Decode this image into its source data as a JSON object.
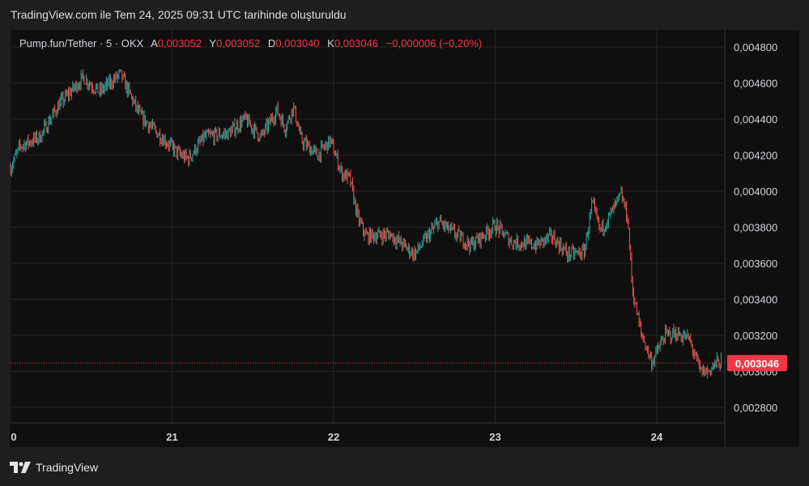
{
  "caption": "TradingView.com ile Tem 24, 2025 09:31 UTC tarihinde oluşturuldu",
  "legend": {
    "symbol": "Pump.fun/Tether · 5 · OKX",
    "open_label": "A",
    "open": "0,003052",
    "high_label": "Y",
    "high": "0,003052",
    "low_label": "D",
    "low": "0,003040",
    "close_label": "K",
    "close": "0,003046",
    "change": "−0,000006 (−0,20%)"
  },
  "footer": {
    "logo_icon": "tradingview-logo-icon",
    "brand": "TradingView"
  },
  "colors": {
    "up": "#26a69a",
    "down": "#ef5350",
    "price_tag": "#f23645",
    "grid": "#232323"
  },
  "chart_data": {
    "type": "candlestick",
    "x_ticks": [
      "0",
      "21",
      "22",
      "23",
      "24"
    ],
    "y_ticks": [
      "0,004800",
      "0,004600",
      "0,004400",
      "0,004200",
      "0,004000",
      "0,003800",
      "0,003600",
      "0,003400",
      "0,003200",
      "0,003000",
      "0,002800"
    ],
    "ylim": [
      0.00275,
      0.00493
    ],
    "last_price": 0.003046,
    "last_price_label": "0,003046",
    "approx_close_path": [
      [
        0,
        0.00413
      ],
      [
        0.06,
        0.00425
      ],
      [
        0.18,
        0.0043
      ],
      [
        0.3,
        0.00448
      ],
      [
        0.45,
        0.00463
      ],
      [
        0.55,
        0.00455
      ],
      [
        0.68,
        0.00465
      ],
      [
        0.8,
        0.00442
      ],
      [
        0.9,
        0.00433
      ],
      [
        1.05,
        0.0042
      ],
      [
        1.1,
        0.00418
      ],
      [
        1.2,
        0.0043
      ],
      [
        1.35,
        0.00432
      ],
      [
        1.45,
        0.0044
      ],
      [
        1.55,
        0.0043
      ],
      [
        1.65,
        0.00445
      ],
      [
        1.7,
        0.00435
      ],
      [
        1.75,
        0.00447
      ],
      [
        1.8,
        0.00428
      ],
      [
        1.9,
        0.0042
      ],
      [
        1.98,
        0.00428
      ],
      [
        2.05,
        0.0041
      ],
      [
        2.1,
        0.00407
      ],
      [
        2.15,
        0.00385
      ],
      [
        2.2,
        0.00375
      ],
      [
        2.35,
        0.00376
      ],
      [
        2.5,
        0.00365
      ],
      [
        2.65,
        0.00383
      ],
      [
        2.85,
        0.0037
      ],
      [
        3.0,
        0.00381
      ],
      [
        3.1,
        0.00372
      ],
      [
        3.25,
        0.0037
      ],
      [
        3.35,
        0.00375
      ],
      [
        3.45,
        0.00365
      ],
      [
        3.55,
        0.00366
      ],
      [
        3.6,
        0.00393
      ],
      [
        3.65,
        0.00378
      ],
      [
        3.72,
        0.00388
      ],
      [
        3.78,
        0.00398
      ],
      [
        3.82,
        0.00385
      ],
      [
        3.85,
        0.00345
      ],
      [
        3.9,
        0.00322
      ],
      [
        3.97,
        0.00305
      ],
      [
        4.05,
        0.0032
      ],
      [
        4.12,
        0.00321
      ],
      [
        4.2,
        0.00318
      ],
      [
        4.27,
        0.003
      ],
      [
        4.32,
        0.003
      ],
      [
        4.37,
        0.00305
      ],
      [
        4.4,
        0.003046
      ]
    ],
    "grid": true
  }
}
